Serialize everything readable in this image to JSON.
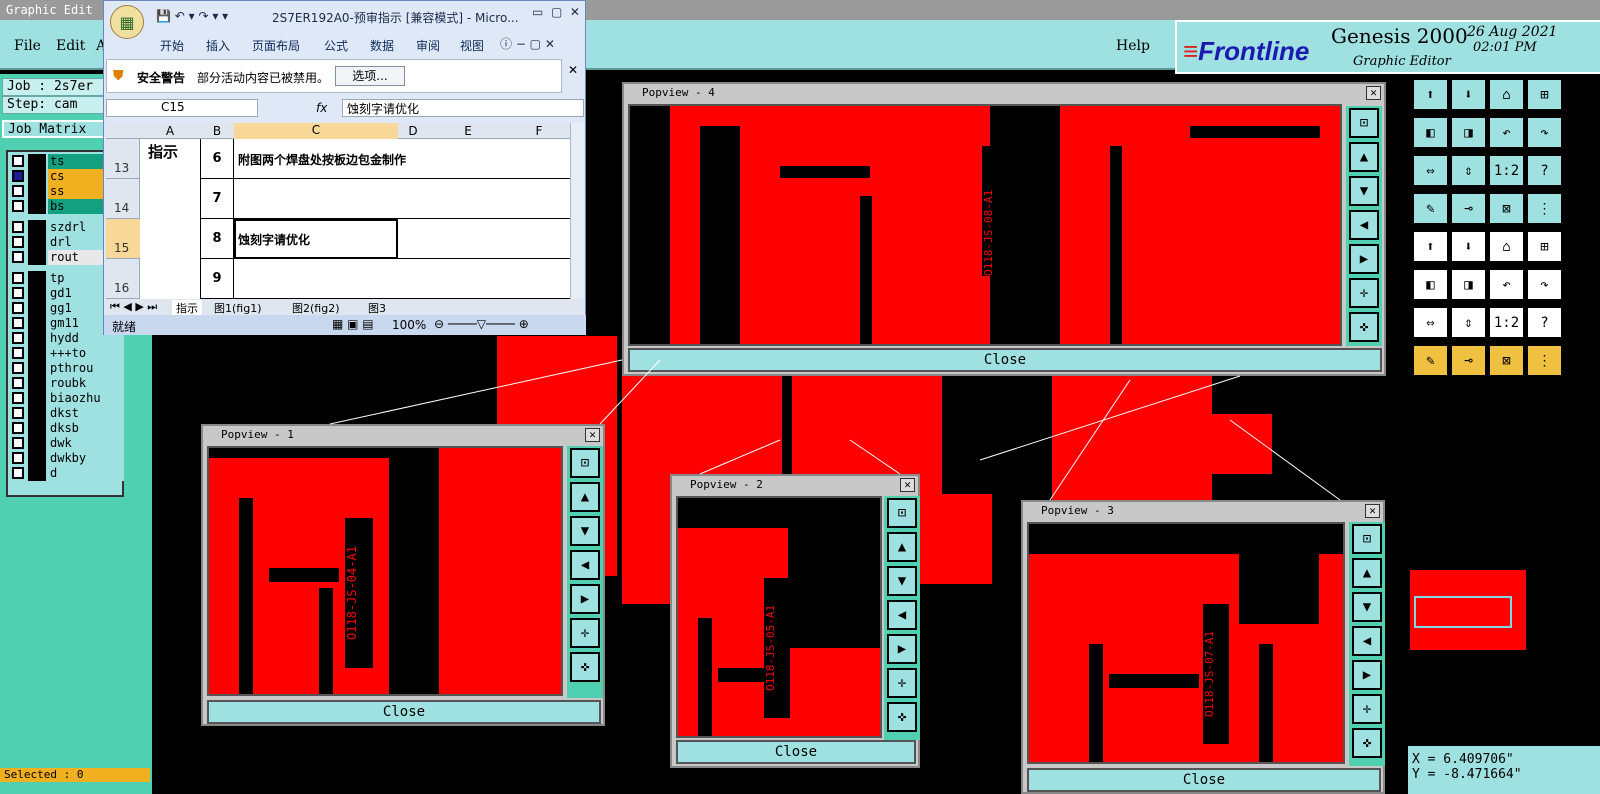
{
  "genesis": {
    "window_title": "Graphic Edit",
    "menu": [
      "File",
      "Edit",
      "A",
      "Help"
    ],
    "brand_logo": "Frontline",
    "product": "Genesis 2000",
    "subtitle": "Graphic Editor",
    "date": "26 Aug 2021",
    "time": "02:01 PM",
    "job": "Job : 2s7er",
    "step": "Step: cam",
    "job_matrix": "Job Matrix",
    "layers": [
      {
        "name": "ts",
        "color": "#12a080",
        "checked": false
      },
      {
        "name": "cs",
        "color": "#f0b020",
        "checked": true
      },
      {
        "name": "ss",
        "color": "#f0b020",
        "checked": false
      },
      {
        "name": "bs",
        "color": "#12a080",
        "checked": false
      },
      {
        "name": "szdrl",
        "color": "#9fe0e0",
        "checked": false
      },
      {
        "name": "drl",
        "color": "#9fe0e0",
        "checked": false
      },
      {
        "name": "rout",
        "color": "#e8e8e8",
        "checked": false
      },
      {
        "name": "tp",
        "color": "#9fe0e0",
        "checked": false
      },
      {
        "name": "gd1",
        "color": "#9fe0e0",
        "checked": false
      },
      {
        "name": "gg1",
        "color": "#9fe0e0",
        "checked": false
      },
      {
        "name": "gm11",
        "color": "#9fe0e0",
        "checked": false
      },
      {
        "name": "hydd",
        "color": "#9fe0e0",
        "checked": false
      },
      {
        "name": "+++to",
        "color": "#9fe0e0",
        "checked": false
      },
      {
        "name": "pthrou",
        "color": "#9fe0e0",
        "checked": false
      },
      {
        "name": "roubk",
        "color": "#9fe0e0",
        "checked": false
      },
      {
        "name": "biaozhu",
        "color": "#9fe0e0",
        "checked": false
      },
      {
        "name": "dkst",
        "color": "#9fe0e0",
        "checked": false
      },
      {
        "name": "dksb",
        "color": "#9fe0e0",
        "checked": false
      },
      {
        "name": "dwk",
        "color": "#9fe0e0",
        "checked": false
      },
      {
        "name": "dwkby",
        "color": "#9fe0e0",
        "checked": false
      },
      {
        "name": "d",
        "color": "#9fe0e0",
        "checked": false
      }
    ],
    "selected": "Selected : 0",
    "coord_x": "X = 6.409706\"",
    "coord_y": "Y = -8.471664\"",
    "right_toolbar_icons": [
      "zoom-home-icon",
      "zoom-in-icon",
      "home-icon",
      "fit-icon",
      "pan-left-icon",
      "pan-right-icon",
      "undo-icon",
      "redo-icon",
      "zoom-fit-icon",
      "zoom-center-icon",
      "scale-icon",
      "help-icon",
      "palette-icon",
      "measure-icon",
      "snap-icon",
      "grid-icon"
    ],
    "popviews": [
      {
        "title": "Popview - 1",
        "close": "Close",
        "label": "O118-JS-04-A1"
      },
      {
        "title": "Popview - 2",
        "close": "Close",
        "label": "O118-JS-05-A1"
      },
      {
        "title": "Popview - 3",
        "close": "Close",
        "label": "O118-JS-07-A1"
      },
      {
        "title": "Popview - 4",
        "close": "Close",
        "label": "O118-JS-08-A1"
      }
    ]
  },
  "excel": {
    "title": "2S7ER192A0-预审指示 [兼容模式] - Micro...",
    "ribbon_tabs": [
      "开始",
      "插入",
      "页面布局",
      "公式",
      "数据",
      "审阅",
      "视图"
    ],
    "security_label": "安全警告",
    "security_msg": "部分活动内容已被禁用。",
    "options_btn": "选项...",
    "name_box": "C15",
    "fx": "fx",
    "formula": "蚀刻字请优化",
    "col_headers": [
      "A",
      "B",
      "C",
      "D",
      "E",
      "F"
    ],
    "rows": [
      {
        "num": "13",
        "a": "指示",
        "b": "6",
        "c": "附图两个焊盘处按板边包金制作"
      },
      {
        "num": "14",
        "a": "",
        "b": "7",
        "c": ""
      },
      {
        "num": "15",
        "a": "",
        "b": "8",
        "c": "蚀刻字请优化"
      },
      {
        "num": "16",
        "a": "",
        "b": "9",
        "c": ""
      }
    ],
    "sheet_tabs": [
      "指示",
      "图1(fig1)",
      "图2(fig2)",
      "图3"
    ],
    "status": "就绪",
    "zoom": "100%"
  }
}
